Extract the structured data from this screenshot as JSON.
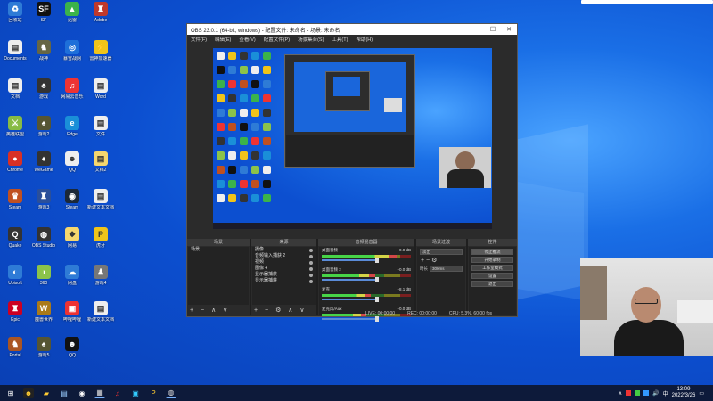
{
  "desktop": {
    "icons": [
      {
        "label": "回收站",
        "color": "#2e7bd6",
        "glyph": "♻"
      },
      {
        "label": "SF",
        "color": "#111",
        "glyph": "SF"
      },
      {
        "label": "迅雷",
        "color": "#3bb34a",
        "glyph": "▲"
      },
      {
        "label": "Adobe",
        "color": "#c0392b",
        "glyph": "♜"
      },
      {
        "label": "Documents",
        "color": "#eee",
        "glyph": "▤"
      },
      {
        "label": "战神",
        "color": "#664",
        "glyph": "♞"
      },
      {
        "label": "暴雪战网",
        "color": "#1e6fd9",
        "glyph": "◎"
      },
      {
        "label": "雷神加速器",
        "color": "#f0c419",
        "glyph": "⚡"
      },
      {
        "label": "文档",
        "color": "#eee",
        "glyph": "▤"
      },
      {
        "label": "游戏",
        "color": "#333",
        "glyph": "♣"
      },
      {
        "label": "网易云音乐",
        "color": "#e33",
        "glyph": "♫"
      },
      {
        "label": "Word",
        "color": "#eee",
        "glyph": "▤"
      },
      {
        "label": "英雄联盟",
        "color": "#8b4",
        "glyph": "⚔"
      },
      {
        "label": "游戏2",
        "color": "#553",
        "glyph": "♠"
      },
      {
        "label": "Edge",
        "color": "#1a8fd8",
        "glyph": "e"
      },
      {
        "label": "文件",
        "color": "#eee",
        "glyph": "▤"
      },
      {
        "label": "Chrome",
        "color": "#d93025",
        "glyph": "●"
      },
      {
        "label": "WeGame",
        "color": "#333",
        "glyph": "♦"
      },
      {
        "label": "QQ",
        "color": "#eee",
        "glyph": "☻"
      },
      {
        "label": "文档2",
        "color": "#f5d76e",
        "glyph": "▤"
      },
      {
        "label": "Steam",
        "color": "#c05020",
        "glyph": "♛"
      },
      {
        "label": "游戏3",
        "color": "#2a4f9a",
        "glyph": "♜"
      },
      {
        "label": "Steam",
        "color": "#1b2838",
        "glyph": "◉"
      },
      {
        "label": "新建文本文档",
        "color": "#eee",
        "glyph": "▤"
      },
      {
        "label": "Quake",
        "color": "#333",
        "glyph": "Q"
      },
      {
        "label": "OBS Studio",
        "color": "#333",
        "glyph": "◍"
      },
      {
        "label": "网易",
        "color": "#f5d76e",
        "glyph": "❖"
      },
      {
        "label": "虎牙",
        "color": "#f0c419",
        "glyph": "P"
      },
      {
        "label": "Ubisoft",
        "color": "#2e7bd6",
        "glyph": "◐"
      },
      {
        "label": "360",
        "color": "#8bc34a",
        "glyph": "◑"
      },
      {
        "label": "网盘",
        "color": "#2e7bd6",
        "glyph": "☁"
      },
      {
        "label": "游戏4",
        "color": "#777",
        "glyph": "♟"
      },
      {
        "label": "Epic",
        "color": "#c02",
        "glyph": "♜"
      },
      {
        "label": "魔兽世界",
        "color": "#aa7a1a",
        "glyph": "W"
      },
      {
        "label": "哔哩哔哩",
        "color": "#e33",
        "glyph": "▣"
      },
      {
        "label": "新建文本文档",
        "color": "#eee",
        "glyph": "▤"
      },
      {
        "label": "Portal",
        "color": "#aa5522",
        "glyph": "♞"
      },
      {
        "label": "游戏5",
        "color": "#553",
        "glyph": "♠"
      },
      {
        "label": "QQ",
        "color": "#111",
        "glyph": "☻"
      }
    ]
  },
  "obs": {
    "title": "OBS 23.0.1 (64-bit, windows) - 配置文件: 未命名 - 场景: 未命名",
    "menu": [
      "文件(F)",
      "编辑(E)",
      "查看(V)",
      "配置文件(P)",
      "场景集合(S)",
      "工具(T)",
      "帮助(H)"
    ],
    "window_buttons": [
      "—",
      "☐",
      "✕"
    ],
    "docks": {
      "scenes": {
        "title": "场景",
        "items": [
          "场景"
        ],
        "footer": "+ − ∧ ∨"
      },
      "sources": {
        "title": "来源",
        "items": [
          "摄像",
          "音频输入捕获 2",
          "视频",
          "图像 4",
          "显示器捕获",
          "显示器捕获"
        ],
        "footer": "+ − ⚙ ∧ ∨"
      },
      "mixer": {
        "title": "音频混音器",
        "channels": [
          {
            "name": "桌面音频",
            "db": "-0.0 dB",
            "level": 0.85,
            "fader": 0.78
          },
          {
            "name": "桌面音频 2",
            "db": "-0.0 dB",
            "level": 0.6,
            "fader": 0.78
          },
          {
            "name": "麦克",
            "db": "-8.1 dB",
            "level": 0.55,
            "fader": 0.78
          },
          {
            "name": "麦克风/Aux",
            "db": "-0.0 dB",
            "level": 0.5,
            "fader": 0.78
          }
        ]
      },
      "transitions": {
        "title": "场景过渡",
        "mode": "淡出",
        "duration_label": "时长",
        "duration": "300ms"
      },
      "controls": {
        "title": "控件",
        "buttons": [
          "停止推流",
          "开始录制",
          "工作室模式",
          "设置",
          "退出"
        ]
      }
    },
    "status": {
      "live": "LIVE: 00:00:00",
      "rec": "REC: 00:00:00",
      "cpu": "CPU: 5.3%, 60.00 fps"
    }
  },
  "taskbar": {
    "clock_time": "13:09",
    "clock_date": "2022/3/26"
  }
}
